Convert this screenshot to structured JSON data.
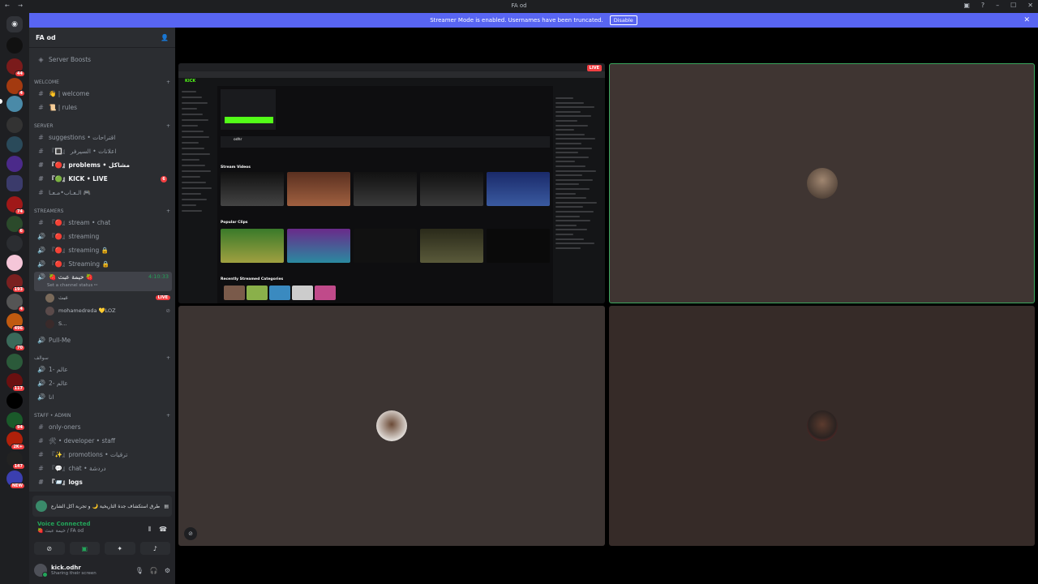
{
  "window": {
    "title": "FA od"
  },
  "banner": {
    "text": "Streamer Mode is enabled. Usernames have been truncated.",
    "button": "Disable",
    "color": "#5865f2"
  },
  "rail": {
    "badges": [
      "44",
      "4",
      "74",
      "6",
      "193",
      "4",
      "496",
      "70",
      "117",
      "94",
      "2K+",
      "147",
      "NEW"
    ]
  },
  "server": {
    "name": "FA od",
    "boosts": "Server Boosts"
  },
  "categories": {
    "welcome": "welcome",
    "server": "SERVER",
    "streamers": "STREAMERS",
    "sawalif": "سوالف",
    "staff": "STAFF • ADMIN"
  },
  "channels": {
    "welcome": "👋 | welcome",
    "rules": "📜 | rules",
    "suggestions": "suggestions • اقتراحات",
    "fraud": "『🔳』 اعلانات • السيرفر",
    "problems": "『🔴』problems • مشاكل",
    "kick": "『🟢』KICK • LIVE",
    "kick_badge": "6",
    "arab": "الـعـاب•مـعـا 🎮",
    "stream_chat": "『🔴』stream • chat",
    "streaming1": "『🔴』streaming",
    "streaming2": "『🔴』streaming 🔒",
    "streaming3": "『🔴』Streaming 🔒",
    "voice_active": "🍓 خيمة عبث 🍓",
    "voice_time": "4:10:33",
    "voice_status": "Set a channel status ✏",
    "pullme": "Pull-Me",
    "alam1": "عالم -1",
    "alam2": "عالم -2",
    "ana": "انا",
    "only_oners": "only-oners",
    "developer": "🛠 • developer • staff",
    "promotions": "『✨』promotions • ترقيات",
    "chat": "『💬』chat • دردشة",
    "logs": "『📨』logs"
  },
  "voice_users": [
    {
      "name": "عبث",
      "live": "LIVE"
    },
    {
      "name": "mohamedreda 💛LOZ",
      "live": ""
    },
    {
      "name": "S...",
      "live": ""
    }
  ],
  "activity": {
    "text": "طرق استكشاف جدة التاريخية 🌙 و تجربة أكل الشارع 🔥 ..."
  },
  "voice": {
    "status": "Voice Connected",
    "location": "🍓 خيمة عبث / FA od"
  },
  "user": {
    "name": "kick.odhr",
    "status": "Sharing their screen"
  },
  "stream": {
    "live_label": "LIVE",
    "brand": "KICK",
    "sections": [
      "Stream Videos",
      "Popular Clips",
      "Recently Streamed Categories"
    ],
    "profile_name": "odhr"
  }
}
